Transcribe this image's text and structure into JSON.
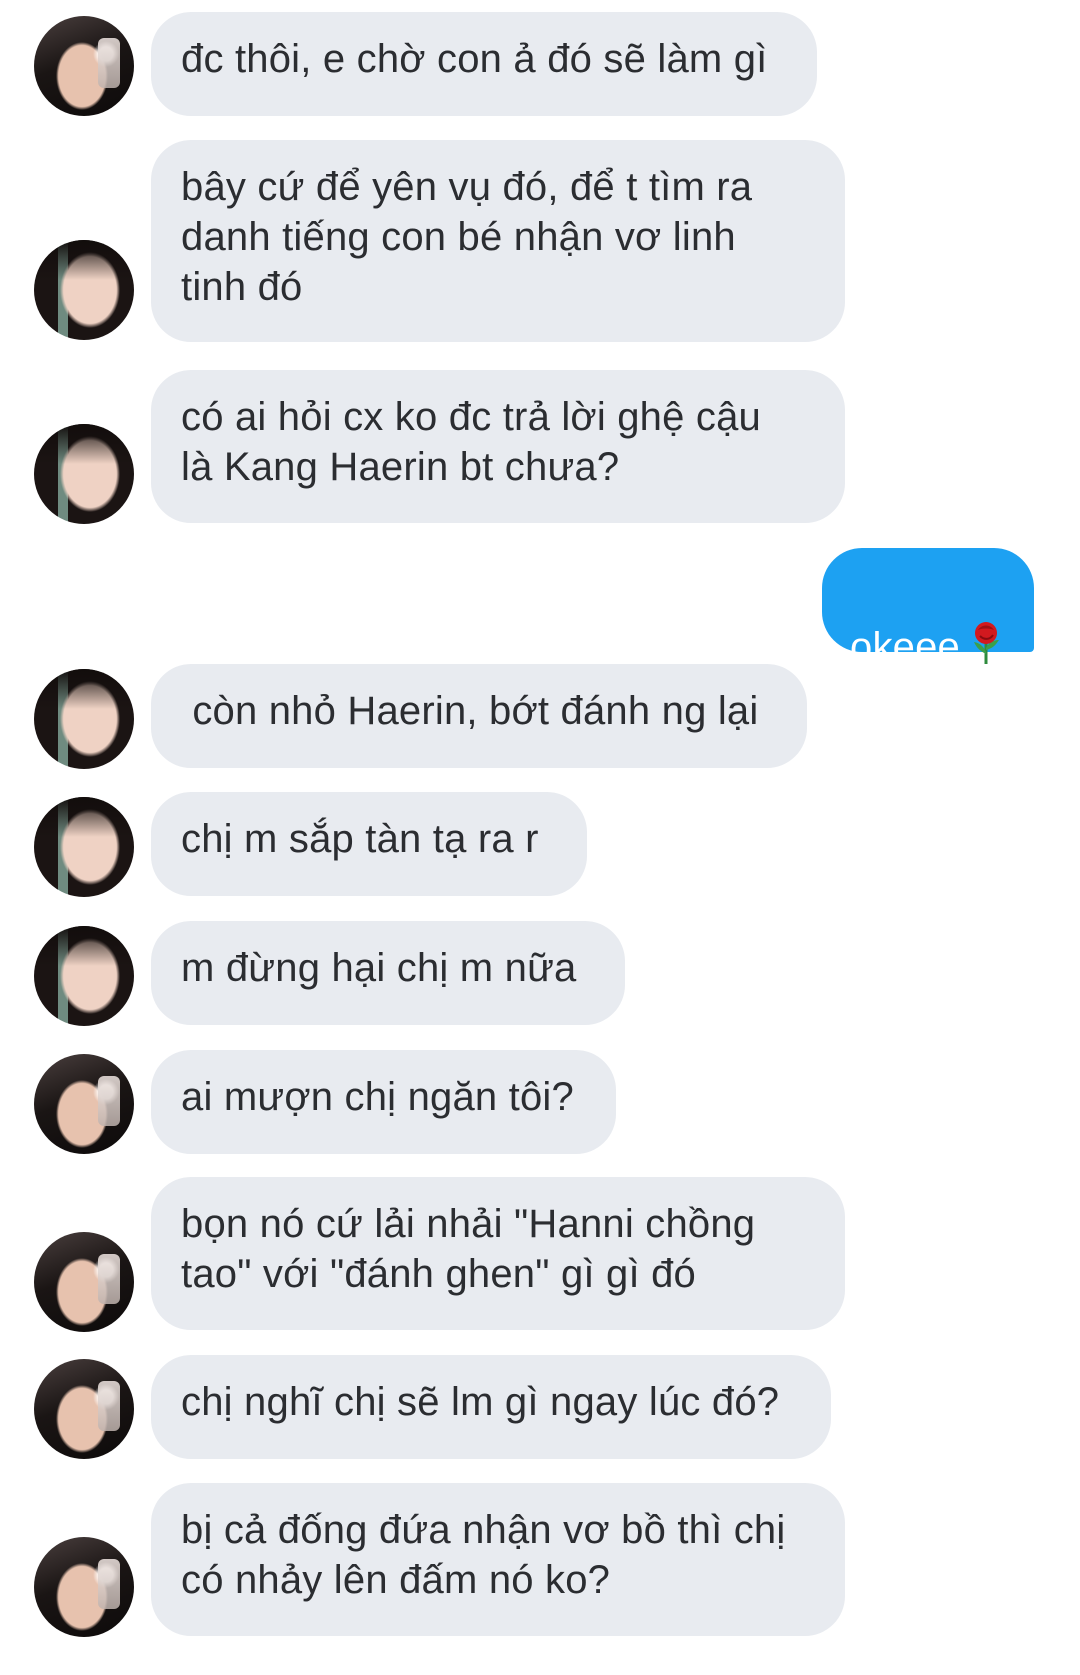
{
  "messages": [
    {
      "side": "received",
      "avatar": "a",
      "text": "đc thôi, e chờ con ả đó sẽ làm gì"
    },
    {
      "side": "received",
      "avatar": "b",
      "text": "bây cứ để yên vụ đó, để t tìm ra\ndanh tiếng con bé nhận vơ linh\ntinh đó"
    },
    {
      "side": "received",
      "avatar": "b",
      "text": "có ai hỏi cx ko đc trả lời ghệ cậu\nlà Kang Haerin bt chưa?"
    },
    {
      "side": "sent",
      "text": "okeee",
      "emoji": "rose-icon"
    },
    {
      "side": "received",
      "avatar": "b",
      "text": " còn nhỏ Haerin, bớt đánh ng lại"
    },
    {
      "side": "received",
      "avatar": "b",
      "text": "chị m sắp tàn tạ ra r"
    },
    {
      "side": "received",
      "avatar": "b",
      "text": "m đừng hại chị m nữa"
    },
    {
      "side": "received",
      "avatar": "a",
      "text": "ai mượn chị ngăn tôi?"
    },
    {
      "side": "received",
      "avatar": "a",
      "text": "bọn nó cứ lải nhải \"Hanni chồng\ntao\" với \"đánh ghen\" gì gì đó"
    },
    {
      "side": "received",
      "avatar": "a",
      "text": "chị nghĩ chị sẽ lm gì ngay lúc đó?"
    },
    {
      "side": "received",
      "avatar": "a",
      "text": "bị cả đống đứa nhận vơ bồ thì chị\ncó nhảy lên đấm nó ko?"
    }
  ],
  "colors": {
    "received_bubble": "#e8ebf0",
    "sent_bubble": "#1da1f2",
    "received_text": "#2b2d31",
    "sent_text": "#ffffff"
  }
}
